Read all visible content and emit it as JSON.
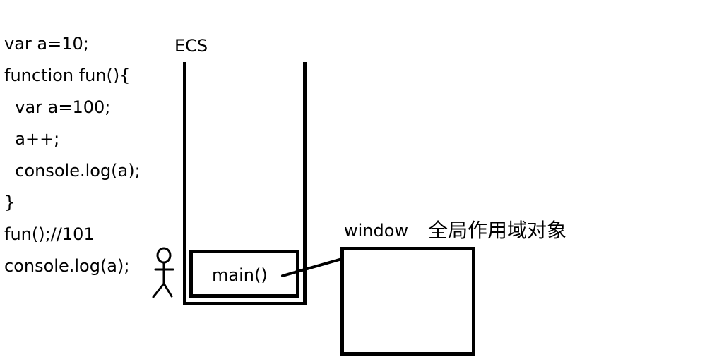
{
  "code_lines": [
    "var a=10;",
    "function fun(){",
    "  var a=100;",
    "  a++;",
    "  console.log(a);",
    "}",
    "fun();//101",
    "console.log(a);"
  ],
  "stack": {
    "label": "ECS",
    "frames": [
      "main()"
    ]
  },
  "window": {
    "label": "window",
    "description": "全局作用域对象"
  }
}
